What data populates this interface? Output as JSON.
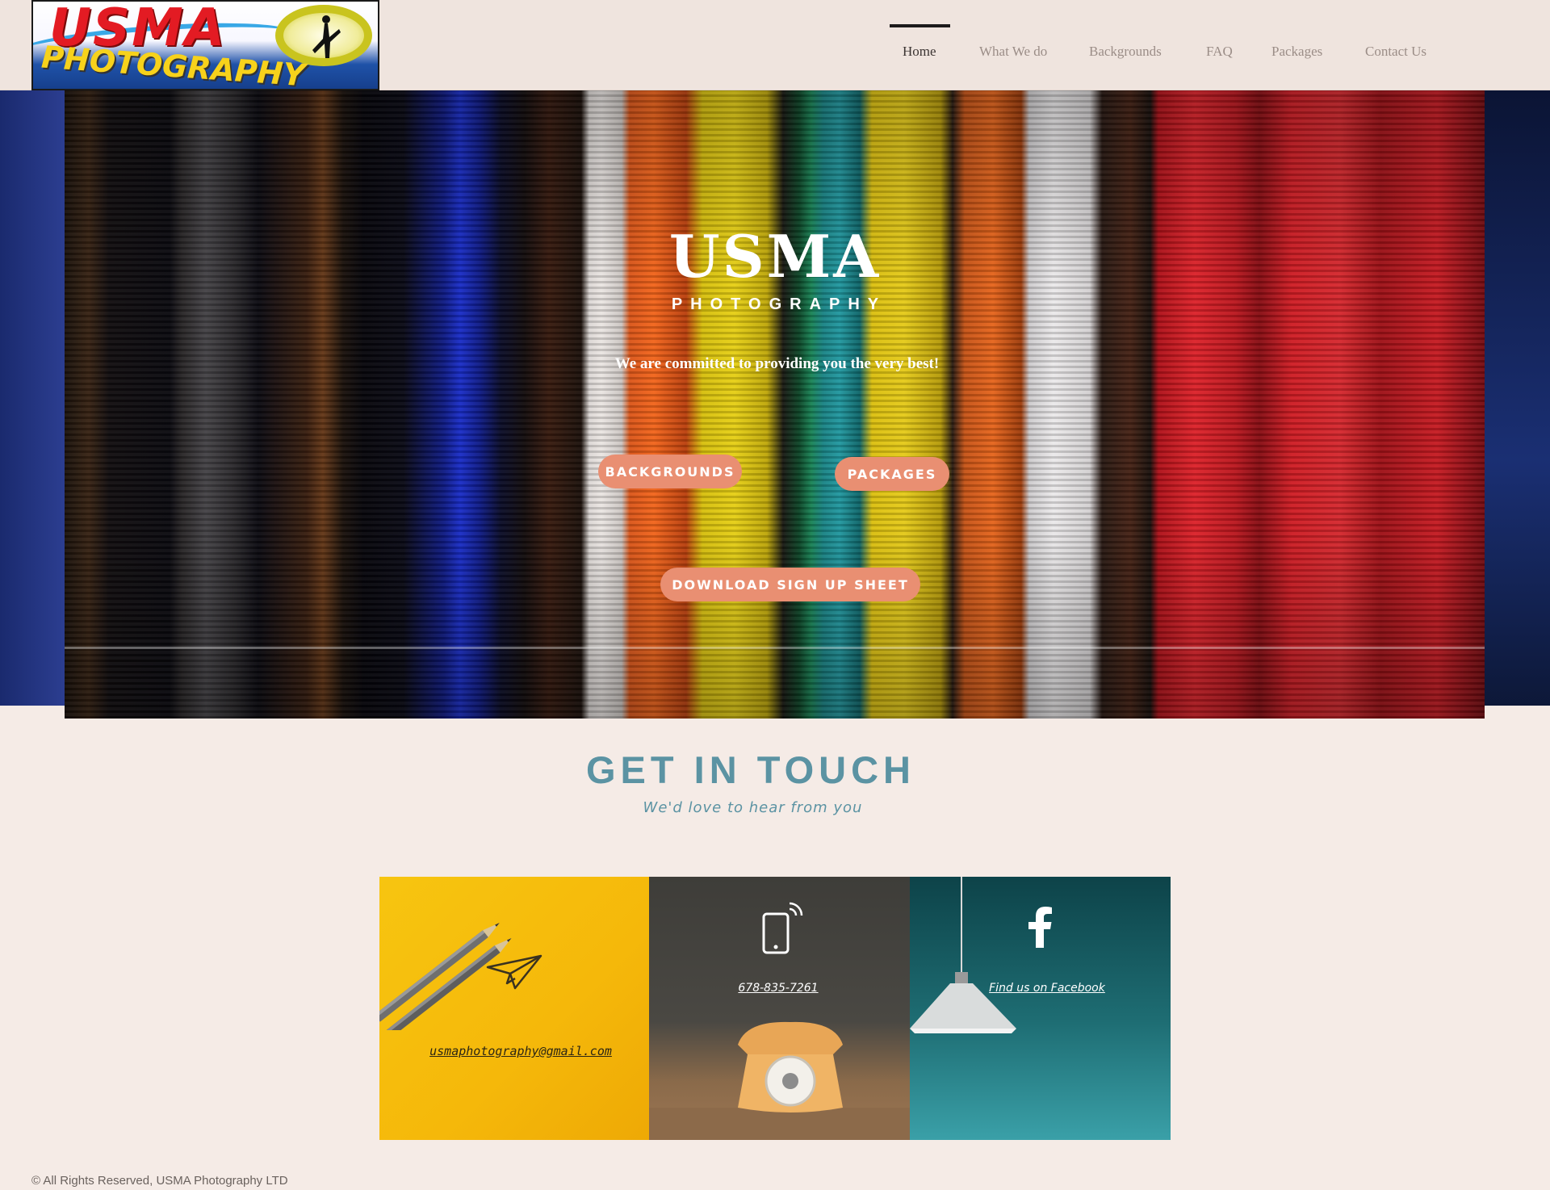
{
  "header": {
    "logo": {
      "line1": "USMA",
      "line2": "PHOTOGRAPHY"
    },
    "nav": [
      {
        "label": "Home",
        "active": true
      },
      {
        "label": "What We do",
        "active": false
      },
      {
        "label": "Backgrounds",
        "active": false
      },
      {
        "label": "FAQ",
        "active": false
      },
      {
        "label": "Packages",
        "active": false
      },
      {
        "label": "Contact Us",
        "active": false
      }
    ]
  },
  "hero": {
    "title": "USMA",
    "subtitle": "PHOTOGRAPHY",
    "tagline": "We are committed to providing you the very best!",
    "buttons": {
      "backgrounds": "BACKGROUNDS",
      "packages": "PACKAGES",
      "signup": "DOWNLOAD SIGN UP SHEET"
    }
  },
  "contact": {
    "title": "GET IN TOUCH",
    "subtitle": "We'd love to hear from you",
    "email": "usmaphotography@gmail.com",
    "phone": "678-835-7261",
    "facebook": "Find us on Facebook"
  },
  "footer": {
    "copyright": "© All Rights Reserved, USMA Photography LTD"
  },
  "colors": {
    "accent_button": "#e98f72",
    "contact_heading": "#5b93a3",
    "page_bg": "#f5ebe6"
  },
  "icons": [
    "paper-plane-icon",
    "smartphone-icon",
    "facebook-icon"
  ]
}
